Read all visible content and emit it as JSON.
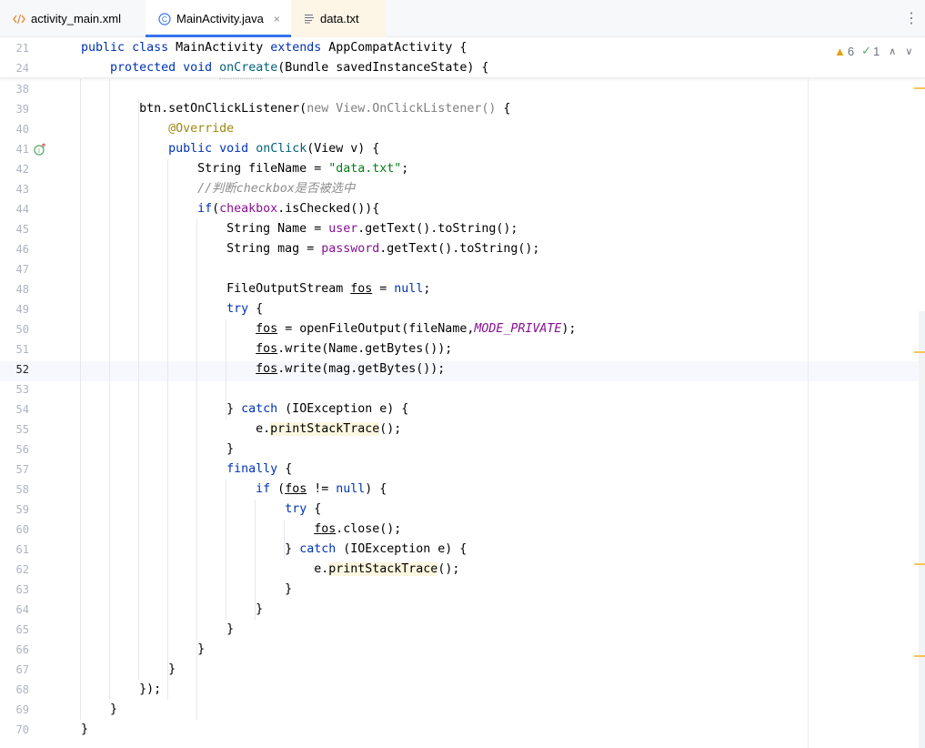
{
  "tabs": [
    {
      "label": "activity_main.xml",
      "icon": "xml-file-icon"
    },
    {
      "label": "MainActivity.java",
      "icon": "java-class-icon",
      "close": "×"
    },
    {
      "label": "data.txt",
      "icon": "text-file-icon"
    }
  ],
  "more_menu": "⋮",
  "inspection": {
    "warnings": "6",
    "ok": "1"
  },
  "sticky": [
    {
      "ln": "21",
      "tokens": [
        [
          "    ",
          ""
        ],
        [
          "public",
          "kw"
        ],
        [
          " ",
          ""
        ],
        [
          "class",
          "kw"
        ],
        [
          " MainActivity ",
          ""
        ],
        [
          "extends",
          "kw"
        ],
        [
          " AppCompatActivity {",
          ""
        ]
      ]
    },
    {
      "ln": "24",
      "tokens": [
        [
          "        ",
          ""
        ],
        [
          "protected",
          "kw"
        ],
        [
          " ",
          ""
        ],
        [
          "void",
          "kw"
        ],
        [
          " ",
          ""
        ],
        [
          "onCreate",
          "fn"
        ],
        [
          "(Bundle savedInstanceState) {",
          ""
        ]
      ]
    }
  ],
  "lines": [
    {
      "ln": "38",
      "tokens": []
    },
    {
      "ln": "39",
      "tokens": [
        [
          "            btn.setOnClickListener(",
          ""
        ],
        [
          "new View.OnClickListener()",
          "gry"
        ],
        [
          " {",
          ""
        ]
      ]
    },
    {
      "ln": "40",
      "tokens": [
        [
          "                ",
          ""
        ],
        [
          "@Override",
          "ann"
        ]
      ]
    },
    {
      "ln": "41",
      "tokens": [
        [
          "                ",
          ""
        ],
        [
          "public",
          "kw"
        ],
        [
          " ",
          ""
        ],
        [
          "void",
          "kw"
        ],
        [
          " ",
          ""
        ],
        [
          "onClick",
          "fn"
        ],
        [
          "(View v) {",
          ""
        ]
      ],
      "gutter": "implements-icon"
    },
    {
      "ln": "42",
      "tokens": [
        [
          "                    String fileName = ",
          ""
        ],
        [
          "\"data.txt\"",
          "str"
        ],
        [
          ";",
          ""
        ]
      ]
    },
    {
      "ln": "43",
      "tokens": [
        [
          "                    ",
          ""
        ],
        [
          "//判断checkbox是否被选中",
          "cmt"
        ]
      ]
    },
    {
      "ln": "44",
      "tokens": [
        [
          "                    ",
          ""
        ],
        [
          "if",
          "kw"
        ],
        [
          "(",
          ""
        ],
        [
          "cheakbox",
          "fld"
        ],
        [
          ".isChecked()){",
          ""
        ]
      ]
    },
    {
      "ln": "45",
      "tokens": [
        [
          "                        String Name = ",
          ""
        ],
        [
          "user",
          "fld"
        ],
        [
          ".getText().toString();",
          ""
        ]
      ]
    },
    {
      "ln": "46",
      "tokens": [
        [
          "                        String mag = ",
          ""
        ],
        [
          "password",
          "fld"
        ],
        [
          ".getText().toString();",
          ""
        ]
      ]
    },
    {
      "ln": "47",
      "tokens": []
    },
    {
      "ln": "48",
      "tokens": [
        [
          "                        FileOutputStream ",
          ""
        ],
        [
          "fos",
          "und"
        ],
        [
          " = ",
          ""
        ],
        [
          "null",
          "kw"
        ],
        [
          ";",
          ""
        ]
      ]
    },
    {
      "ln": "49",
      "tokens": [
        [
          "                        ",
          ""
        ],
        [
          "try",
          "kw"
        ],
        [
          " {",
          ""
        ]
      ]
    },
    {
      "ln": "50",
      "tokens": [
        [
          "                            ",
          ""
        ],
        [
          "fos",
          "und"
        ],
        [
          " = openFileOutput(fileName,",
          ""
        ],
        [
          "MODE_PRIVATE",
          "cst"
        ],
        [
          ");",
          ""
        ]
      ]
    },
    {
      "ln": "51",
      "tokens": [
        [
          "                            ",
          ""
        ],
        [
          "fos",
          "und"
        ],
        [
          ".write(Name.getBytes());",
          ""
        ]
      ]
    },
    {
      "ln": "52",
      "tokens": [
        [
          "                            ",
          ""
        ],
        [
          "fos",
          "und"
        ],
        [
          ".write(mag.getBytes());",
          ""
        ]
      ],
      "current": true
    },
    {
      "ln": "53",
      "tokens": []
    },
    {
      "ln": "54",
      "tokens": [
        [
          "                        } ",
          ""
        ],
        [
          "catch",
          "kw"
        ],
        [
          " (IOException e) {",
          ""
        ]
      ]
    },
    {
      "ln": "55",
      "tokens": [
        [
          "                            e.",
          ""
        ],
        [
          "printStackTrace",
          "hl"
        ],
        [
          "();",
          ""
        ]
      ]
    },
    {
      "ln": "56",
      "tokens": [
        [
          "                        }",
          ""
        ]
      ]
    },
    {
      "ln": "57",
      "tokens": [
        [
          "                        ",
          ""
        ],
        [
          "finally",
          "kw"
        ],
        [
          " {",
          ""
        ]
      ]
    },
    {
      "ln": "58",
      "tokens": [
        [
          "                            ",
          ""
        ],
        [
          "if",
          "kw"
        ],
        [
          " (",
          ""
        ],
        [
          "fos",
          "und"
        ],
        [
          " != ",
          ""
        ],
        [
          "null",
          "kw"
        ],
        [
          ") {",
          ""
        ]
      ]
    },
    {
      "ln": "59",
      "tokens": [
        [
          "                                ",
          ""
        ],
        [
          "try",
          "kw"
        ],
        [
          " {",
          ""
        ]
      ]
    },
    {
      "ln": "60",
      "tokens": [
        [
          "                                    ",
          ""
        ],
        [
          "fos",
          "und"
        ],
        [
          ".close();",
          ""
        ]
      ]
    },
    {
      "ln": "61",
      "tokens": [
        [
          "                                } ",
          ""
        ],
        [
          "catch",
          "kw"
        ],
        [
          " (IOException e) {",
          ""
        ]
      ]
    },
    {
      "ln": "62",
      "tokens": [
        [
          "                                    e.",
          ""
        ],
        [
          "printStackTrace",
          "hl"
        ],
        [
          "();",
          ""
        ]
      ]
    },
    {
      "ln": "63",
      "tokens": [
        [
          "                                }",
          ""
        ]
      ]
    },
    {
      "ln": "64",
      "tokens": [
        [
          "                            }",
          ""
        ]
      ]
    },
    {
      "ln": "65",
      "tokens": [
        [
          "                        }",
          ""
        ]
      ]
    },
    {
      "ln": "66",
      "tokens": [
        [
          "                    }",
          ""
        ]
      ]
    },
    {
      "ln": "67",
      "tokens": [
        [
          "                }",
          ""
        ]
      ]
    },
    {
      "ln": "68",
      "tokens": [
        [
          "            });",
          ""
        ]
      ]
    },
    {
      "ln": "69",
      "tokens": [
        [
          "        }",
          ""
        ]
      ]
    },
    {
      "ln": "70",
      "tokens": [
        [
          "    }",
          ""
        ]
      ]
    }
  ]
}
